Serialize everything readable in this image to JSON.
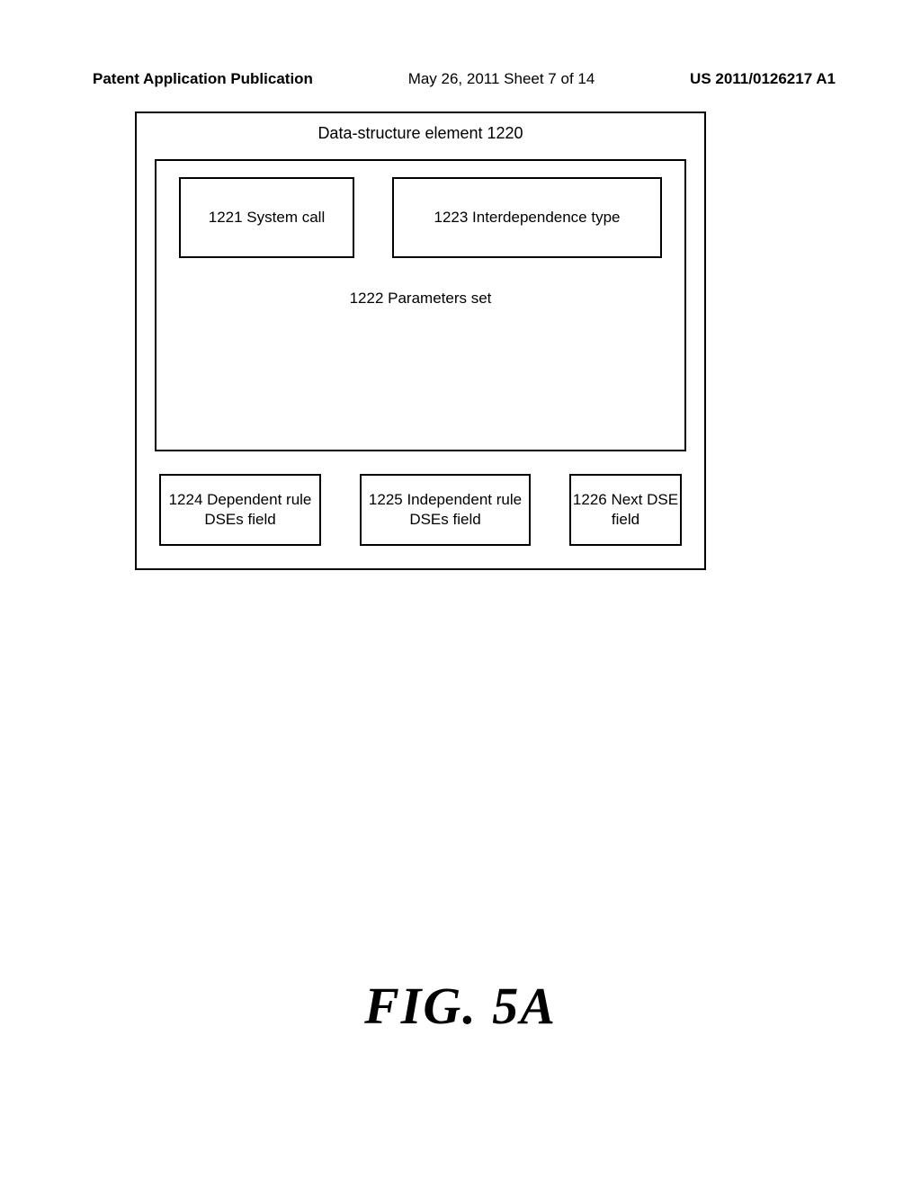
{
  "header": {
    "publication_label": "Patent Application Publication",
    "date_sheet": "May 26, 2011   Sheet 7 of 14",
    "publication_number": "US 2011/0126217 A1"
  },
  "diagram": {
    "title": "Data-structure element 1220",
    "box_system_call": "1221 System call",
    "box_interdependence": "1223 Interdependence type",
    "box_parameters": "1222 Parameters set",
    "box_dependent": "1224 Dependent rule DSEs field",
    "box_independent": "1225 Independent rule DSEs field",
    "box_next": "1226 Next DSE field"
  },
  "figure_label": "FIG. 5A"
}
